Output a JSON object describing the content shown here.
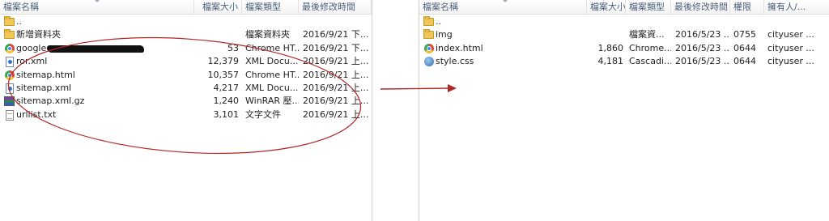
{
  "left_pane": {
    "columns": [
      "檔案名稱",
      "檔案大小",
      "檔案類型",
      "最後修改時間"
    ],
    "rows": [
      {
        "icon": "folder-icon",
        "name": "..",
        "size": "",
        "type": "",
        "modified": ""
      },
      {
        "icon": "folder-icon",
        "name": "新增資料夾",
        "size": "",
        "type": "檔案資料夾",
        "modified": "2016/9/21 下..."
      },
      {
        "icon": "chrome-icon",
        "name": "google",
        "size": "53",
        "type": "Chrome HT...",
        "modified": "2016/9/21 下..."
      },
      {
        "icon": "xml-icon",
        "name": "ror.xml",
        "size": "12,379",
        "type": "XML Docu...",
        "modified": "2016/9/21 上..."
      },
      {
        "icon": "chrome-icon",
        "name": "sitemap.html",
        "size": "10,357",
        "type": "Chrome HT...",
        "modified": "2016/9/21 上..."
      },
      {
        "icon": "xml-icon",
        "name": "sitemap.xml",
        "size": "4,217",
        "type": "XML Docu...",
        "modified": "2016/9/21 上..."
      },
      {
        "icon": "rar-icon",
        "name": "sitemap.xml.gz",
        "size": "1,240",
        "type": "WinRAR 壓...",
        "modified": "2016/9/21 上..."
      },
      {
        "icon": "doc-icon",
        "name": "urllist.txt",
        "size": "3,101",
        "type": "文字文件",
        "modified": "2016/9/21 上..."
      }
    ]
  },
  "right_pane": {
    "columns": [
      "檔案名稱",
      "檔案大小",
      "檔案類型",
      "最後修改時間",
      "權限",
      "擁有人/..."
    ],
    "rows": [
      {
        "icon": "folder-icon",
        "name": "..",
        "size": "",
        "type": "",
        "modified": "",
        "perm": "",
        "owner": ""
      },
      {
        "icon": "folder-icon",
        "name": "img",
        "size": "",
        "type": "檔案資...",
        "modified": "2016/5/23 ...",
        "perm": "0755",
        "owner": "cityuser ..."
      },
      {
        "icon": "chrome-icon",
        "name": "index.html",
        "size": "1,860",
        "type": "Chrome...",
        "modified": "2016/5/23 ...",
        "perm": "0644",
        "owner": "cityuser ..."
      },
      {
        "icon": "css-icon",
        "name": "style.css",
        "size": "4,181",
        "type": "Cascadi...",
        "modified": "2016/5/23 ...",
        "perm": "0644",
        "owner": "cityuser ..."
      }
    ]
  },
  "annotation": {
    "color": "#b32626"
  }
}
